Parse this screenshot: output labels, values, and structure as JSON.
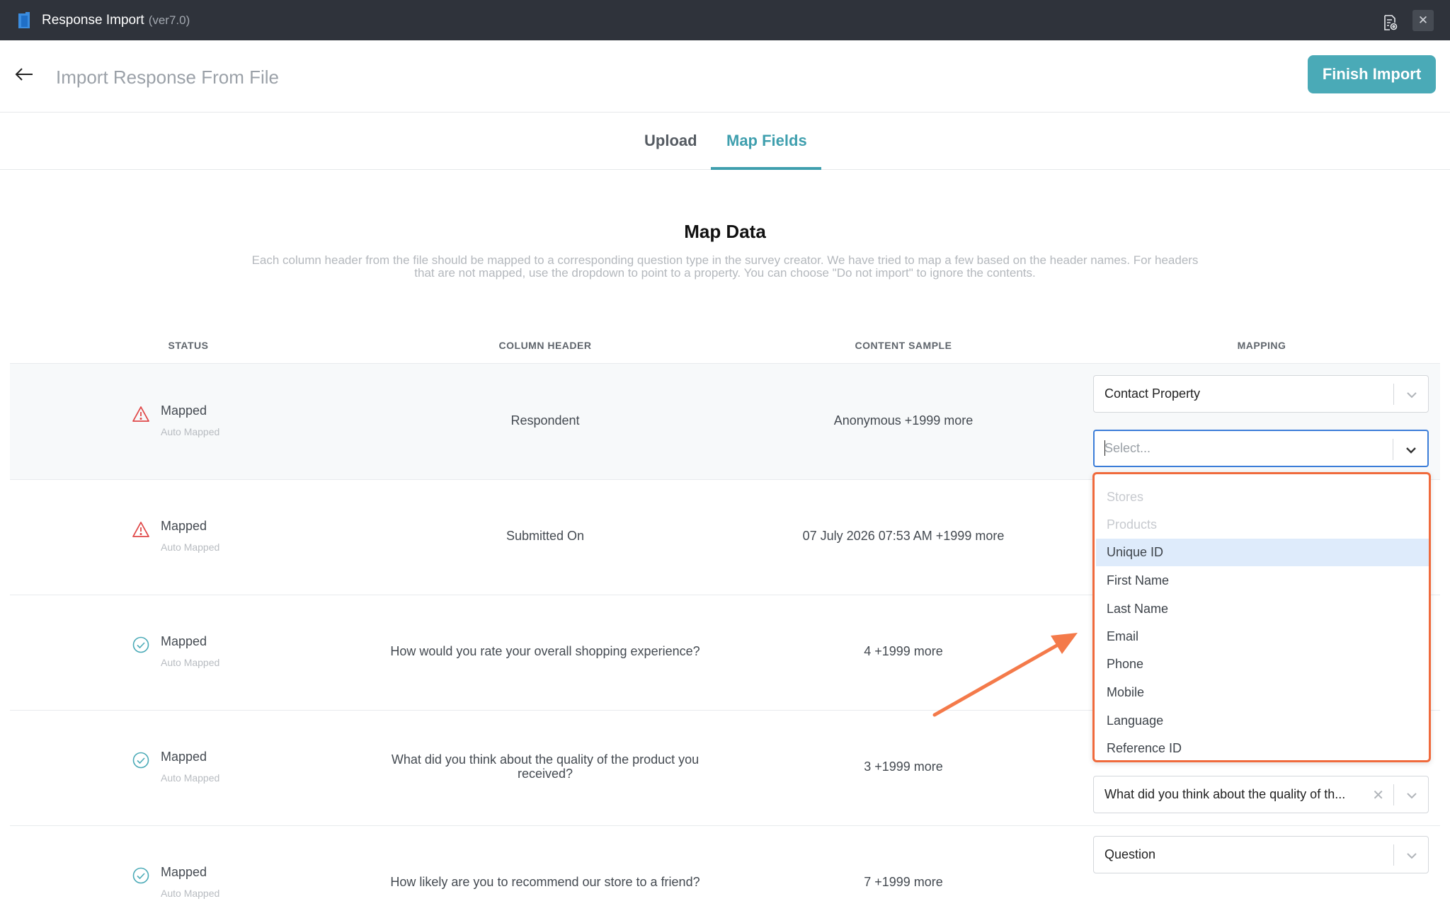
{
  "app": {
    "title": "Response Import",
    "version": "(ver7.0)"
  },
  "header": {
    "page_title": "Import Response From File",
    "finish_button": "Finish Import"
  },
  "tabs": [
    {
      "label": "Upload"
    },
    {
      "label": "Map Fields",
      "active": true
    }
  ],
  "intro": {
    "title": "Map Data",
    "description_line1": "Each column header from the file should be mapped to a corresponding question type in the survey creator. We have tried to map a few based on the header names. For headers",
    "description_line2": "that are not mapped, use the dropdown to point to a property. You can choose \"Do not import\" to ignore the contents."
  },
  "columns": {
    "status": "STATUS",
    "column_header": "COLUMN HEADER",
    "content_sample": "CONTENT SAMPLE",
    "mapping": "MAPPING"
  },
  "rows": [
    {
      "status": "Mapped",
      "status_sub": "Auto Mapped",
      "status_icon": "warning",
      "column_header": "Respondent",
      "content_sample": "Anonymous +1999 more",
      "mapping_type": "Contact Property",
      "mapping_value_placeholder": "Select..."
    },
    {
      "status": "Mapped",
      "status_sub": "Auto Mapped",
      "status_icon": "warning",
      "column_header": "Submitted On",
      "content_sample": "07 July 2026 07:53 AM +1999 more"
    },
    {
      "status": "Mapped",
      "status_sub": "Auto Mapped",
      "status_icon": "check",
      "column_header": "How would you rate your overall shopping experience?",
      "content_sample": "4 +1999 more"
    },
    {
      "status": "Mapped",
      "status_sub": "Auto Mapped",
      "status_icon": "check",
      "column_header_line1": "What did you think about the quality of the product you",
      "column_header_line2": "received?",
      "content_sample": "3 +1999 more",
      "mapping_value": "What did you think about the quality of th..."
    },
    {
      "status": "Mapped",
      "status_sub": "Auto Mapped",
      "status_icon": "check",
      "column_header": "How likely are you to recommend our store to a friend?",
      "content_sample": "7 +1999 more",
      "mapping_type": "Question"
    }
  ],
  "dropdown_options": [
    {
      "label": "Stores",
      "disabled": true
    },
    {
      "label": "Products",
      "disabled": true
    },
    {
      "label": "Unique ID",
      "highlighted": true
    },
    {
      "label": "First Name"
    },
    {
      "label": "Last Name"
    },
    {
      "label": "Email"
    },
    {
      "label": "Phone"
    },
    {
      "label": "Mobile"
    },
    {
      "label": "Language"
    },
    {
      "label": "Reference ID"
    }
  ],
  "colors": {
    "accent": "#4aaab7",
    "titlebar": "#2f333b",
    "highlight_border": "#f06a3c",
    "warning": "#e04848",
    "check": "#4aaab7"
  }
}
